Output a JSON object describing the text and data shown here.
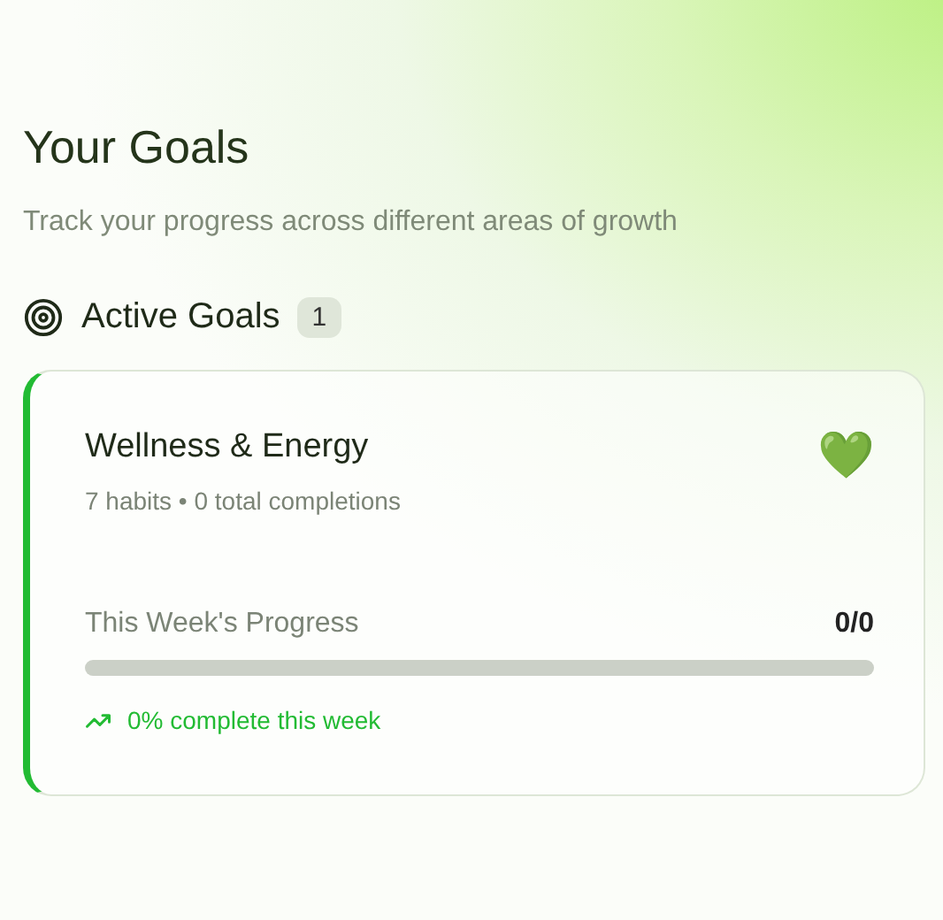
{
  "header": {
    "title": "Your Goals",
    "subtitle": "Track your progress across different areas of growth"
  },
  "section": {
    "title": "Active Goals",
    "count": "1"
  },
  "goals": [
    {
      "title": "Wellness & Energy",
      "emoji": "💚",
      "meta": "7 habits • 0 total completions",
      "progress_label": "This Week's Progress",
      "progress_value": "0/0",
      "level": 0,
      "trend": "0% complete this week",
      "color": "#22bb33"
    }
  ]
}
